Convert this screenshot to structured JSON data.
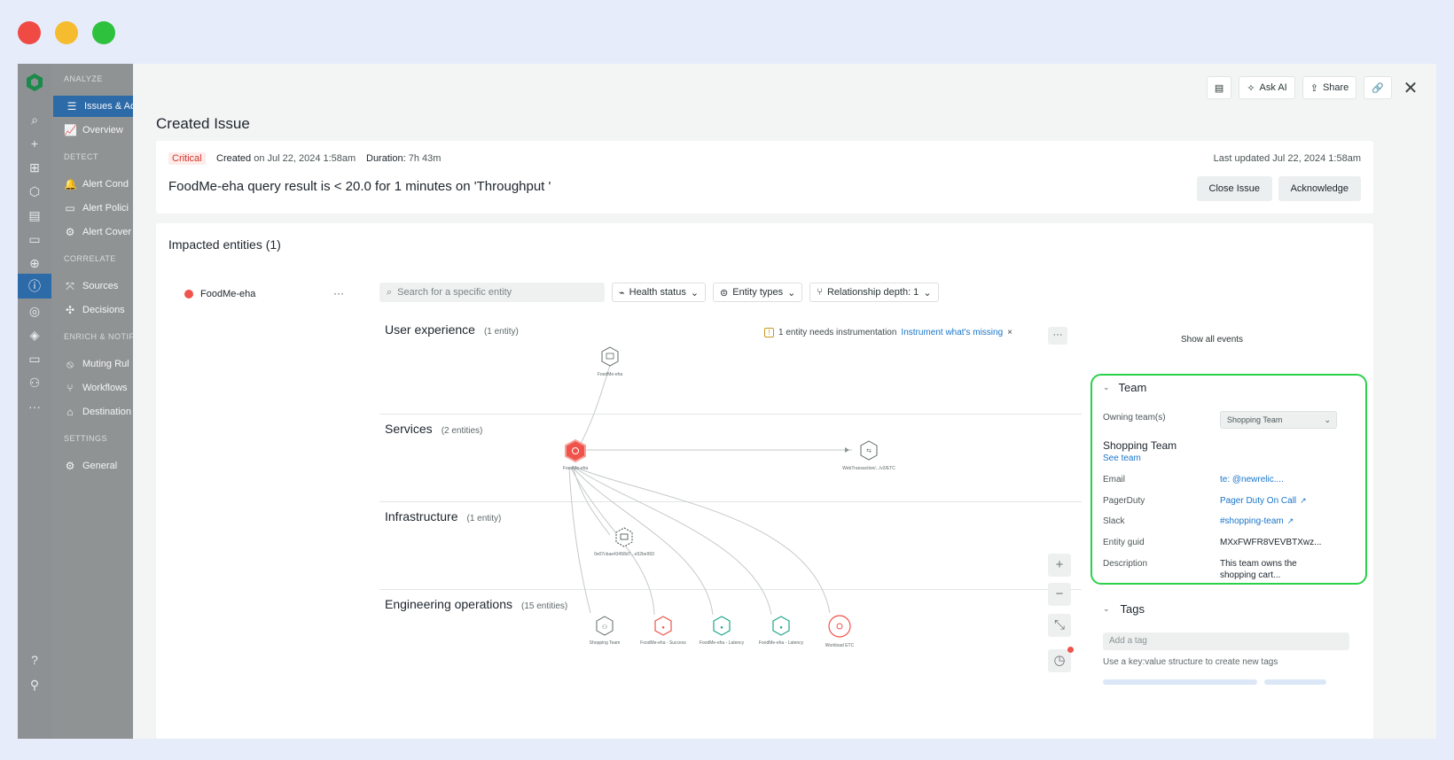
{
  "header": {
    "ask_ai": "Ask AI",
    "share": "Share"
  },
  "nav": {
    "sections": {
      "analyze": "ANALYZE",
      "detect": "DETECT",
      "correlate": "CORRELATE",
      "enrich": "ENRICH & NOTIFY",
      "settings": "SETTINGS"
    },
    "items": {
      "issues": "Issues & Ac",
      "overview": "Overview",
      "alert_conditions": "Alert Cond",
      "alert_policies": "Alert Polici",
      "alert_coverage": "Alert Cover",
      "sources": "Sources",
      "decisions": "Decisions",
      "muting_rules": "Muting Rul",
      "workflows": "Workflows",
      "destinations": "Destination",
      "general": "General"
    }
  },
  "page": {
    "title": "Created Issue"
  },
  "issue": {
    "severity": "Critical",
    "created_label": "Created",
    "created_value": "on Jul 22, 2024 1:58am",
    "duration_label": "Duration:",
    "duration_value": "7h 43m",
    "last_updated": "Last updated Jul 22, 2024 1:58am",
    "title": "FoodMe-eha query result is < 20.0 for 1 minutes on 'Throughput '",
    "close_button": "Close Issue",
    "ack_button": "Acknowledge"
  },
  "impacted": {
    "title": "Impacted entities (1)",
    "entity_name": "FoodMe-eha",
    "more": "···"
  },
  "filters": {
    "search_placeholder": "Search for a specific entity",
    "health": "Health status",
    "types": "Entity types",
    "depth": "Relationship depth: 1"
  },
  "layers": [
    {
      "name": "User experience",
      "count": "(1 entity)"
    },
    {
      "name": "Services",
      "count": "(2 entities)"
    },
    {
      "name": "Infrastructure",
      "count": "(1 entity)"
    },
    {
      "name": "Engineering operations",
      "count": "(15 entities)"
    }
  ],
  "instrumentation": {
    "text": "1 entity needs instrumentation",
    "link": "Instrument what's missing",
    "close": "×"
  },
  "show_all_events": "Show all events",
  "graph_labels": {
    "ux_node": "FoodMe-eha",
    "svc_main": "FoodMe-eha",
    "svc_web": "WebTransaction/.../v2/ETC",
    "infra_node": "0e07cbae43458d7...e52be993",
    "eng_1": "Shopping Team",
    "eng_2": "FoodMe-eha - Success",
    "eng_3": "FoodMe-eha - Latency",
    "eng_4": "FoodMe-eha - Latency",
    "eng_5": "Workload ETC"
  },
  "team": {
    "header": "Team",
    "owning_label": "Owning team(s)",
    "owning_value": "Shopping Team",
    "name": "Shopping Team",
    "see_team": "See team",
    "email_label": "Email",
    "email_value": "te:            @newrelic....",
    "pagerduty_label": "PagerDuty",
    "pagerduty_value": "Pager Duty On Call",
    "slack_label": "Slack",
    "slack_value": "#shopping-team",
    "guid_label": "Entity guid",
    "guid_value": "MXxFWFR8VEVBTXwz...",
    "desc_label": "Description",
    "desc_line1": "This team owns the",
    "desc_line2": "shopping cart..."
  },
  "tags": {
    "header": "Tags",
    "placeholder": "Add a tag",
    "hint": "Use a key:value structure to create new tags"
  },
  "colors": {
    "critical": "#d6332b",
    "accent": "#2d6aa8",
    "link": "#1a75c9",
    "highlight": "#2ad14a",
    "node_red": "#f0534b",
    "node_teal": "#1ea68a"
  }
}
